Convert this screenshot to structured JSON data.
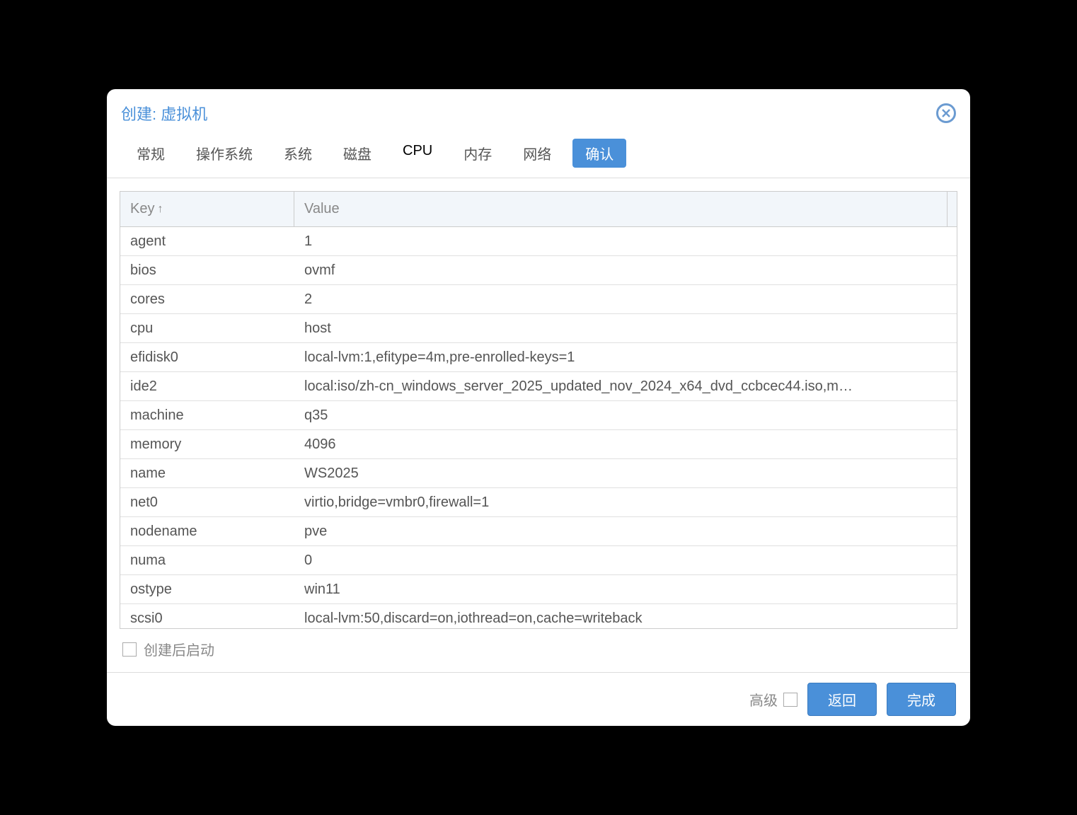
{
  "dialog": {
    "title": "创建: 虚拟机"
  },
  "tabs": {
    "general": "常规",
    "os": "操作系统",
    "system": "系统",
    "disk": "磁盘",
    "cpu": "CPU",
    "memory": "内存",
    "network": "网络",
    "confirm": "确认"
  },
  "table": {
    "header_key": "Key",
    "header_value": "Value",
    "rows": [
      {
        "key": "agent",
        "value": "1"
      },
      {
        "key": "bios",
        "value": "ovmf"
      },
      {
        "key": "cores",
        "value": "2"
      },
      {
        "key": "cpu",
        "value": "host"
      },
      {
        "key": "efidisk0",
        "value": "local-lvm:1,efitype=4m,pre-enrolled-keys=1"
      },
      {
        "key": "ide2",
        "value": "local:iso/zh-cn_windows_server_2025_updated_nov_2024_x64_dvd_ccbcec44.iso,m…"
      },
      {
        "key": "machine",
        "value": "q35"
      },
      {
        "key": "memory",
        "value": "4096"
      },
      {
        "key": "name",
        "value": "WS2025"
      },
      {
        "key": "net0",
        "value": "virtio,bridge=vmbr0,firewall=1"
      },
      {
        "key": "nodename",
        "value": "pve"
      },
      {
        "key": "numa",
        "value": "0"
      },
      {
        "key": "ostype",
        "value": "win11"
      },
      {
        "key": "scsi0",
        "value": "local-lvm:50,discard=on,iothread=on,cache=writeback"
      }
    ]
  },
  "below": {
    "start_after_create": "创建后启动"
  },
  "footer": {
    "advanced": "高级",
    "back": "返回",
    "finish": "完成"
  }
}
